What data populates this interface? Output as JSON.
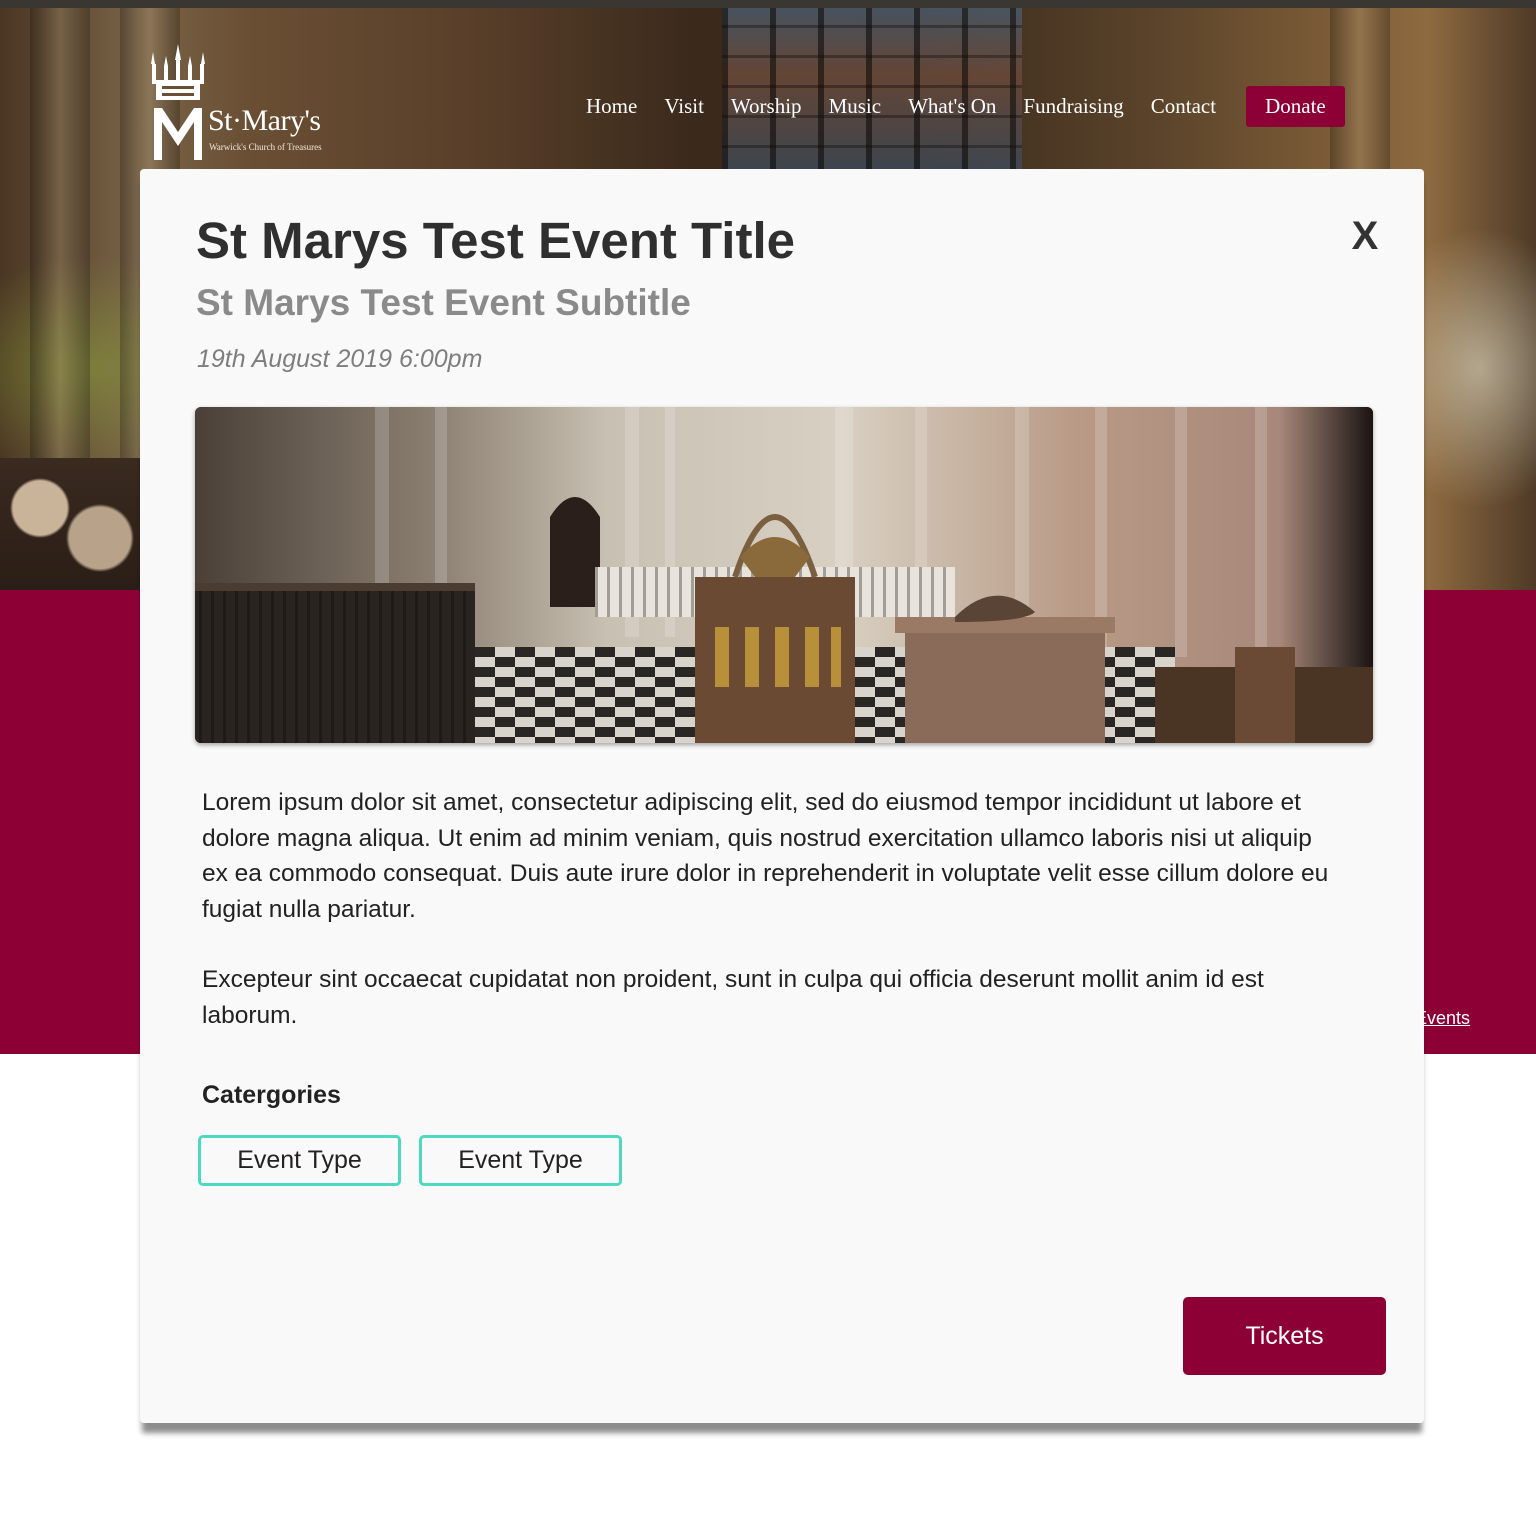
{
  "site": {
    "brand_name": "St·Mary's",
    "brand_tagline": "Warwick's Church of Treasures",
    "nav": [
      "Home",
      "Visit",
      "Worship",
      "Music",
      "What's On",
      "Fundraising",
      "Contact"
    ],
    "donate_label": "Donate",
    "background_link": "ge Events"
  },
  "modal": {
    "title": "St Marys Test Event Title",
    "subtitle": "St Marys Test Event Subtitle",
    "date": "19th August 2019 6:00pm",
    "close_label": "X",
    "image_alt": "Church chancel interior with tombs and ironwork",
    "description": [
      "Lorem ipsum dolor sit amet, consectetur adipiscing elit, sed do eiusmod tempor incididunt ut labore et dolore magna aliqua. Ut enim ad minim veniam, quis nostrud exercitation ullamco laboris nisi ut aliquip ex ea commodo consequat. Duis aute irure dolor in reprehenderit in voluptate velit esse cillum dolore eu fugiat nulla pariatur.",
      "Excepteur sint occaecat cupidatat non proident, sunt in culpa qui officia deserunt mollit anim id est laborum."
    ],
    "categories_heading": "Catergories",
    "categories": [
      "Event Type",
      "Event Type"
    ],
    "tickets_label": "Tickets"
  },
  "colors": {
    "brand": "#8d0036",
    "tag_border": "#4cd9bd",
    "modal_bg": "#f9f9f9"
  },
  "icons": [
    "church-logo-icon",
    "close-icon"
  ]
}
